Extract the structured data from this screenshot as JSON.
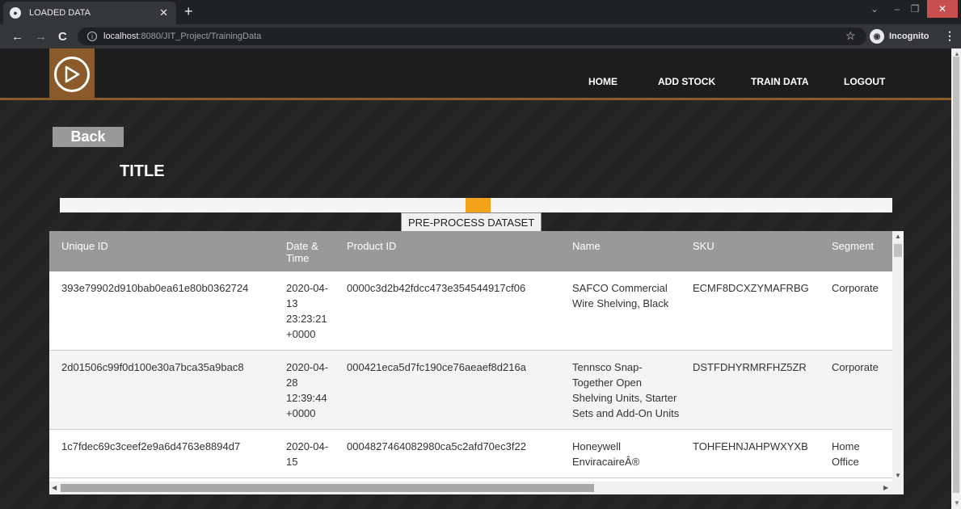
{
  "browser": {
    "tab_title": "LOADED DATA",
    "url_host": "localhost",
    "url_path": ":8080/JIT_Project/TrainingData",
    "incognito_label": "Incognito"
  },
  "nav": {
    "items": [
      {
        "label": "HOME"
      },
      {
        "label": "ADD STOCK"
      },
      {
        "label": "TRAIN DATA"
      },
      {
        "label": "LOGOUT"
      }
    ]
  },
  "page": {
    "back_label": "Back",
    "title": "TITLE",
    "preprocess_label": "PRE-PROCESS DATASET",
    "progress_fraction": 0.03
  },
  "table": {
    "columns": [
      "Unique ID",
      "Date & Time",
      "Product ID",
      "Name",
      "SKU",
      "Segment"
    ],
    "rows": [
      {
        "unique_id": "393e79902d910bab0ea61e80b0362724",
        "date": "2020-04-13 23:23:21 +0000",
        "product_id": "0000c3d2b42fdcc473e354544917cf06",
        "name": "SAFCO Commercial Wire Shelving, Black",
        "sku": "ECMF8DCXZYMAFRBG",
        "segment": "Corporate"
      },
      {
        "unique_id": "2d01506c99f0d100e30a7bca35a9bac8",
        "date": "2020-04-28 12:39:44 +0000",
        "product_id": "000421eca5d7fc190ce76aeaef8d216a",
        "name": "Tennsco Snap-Together Open Shelving Units, Starter Sets and Add-On Units",
        "sku": "DSTFDHYRMRFHZ5ZR",
        "segment": "Corporate"
      },
      {
        "unique_id": "1c7fdec69c3ceef2e9a6d4763e8894d7",
        "date": "2020-04-15",
        "product_id": "0004827464082980ca5c2afd70ec3f22",
        "name": "Honeywell EnviracaireÂ®",
        "sku": "TOHFEHNJAHPWXYXB",
        "segment": "Home Office"
      }
    ]
  }
}
